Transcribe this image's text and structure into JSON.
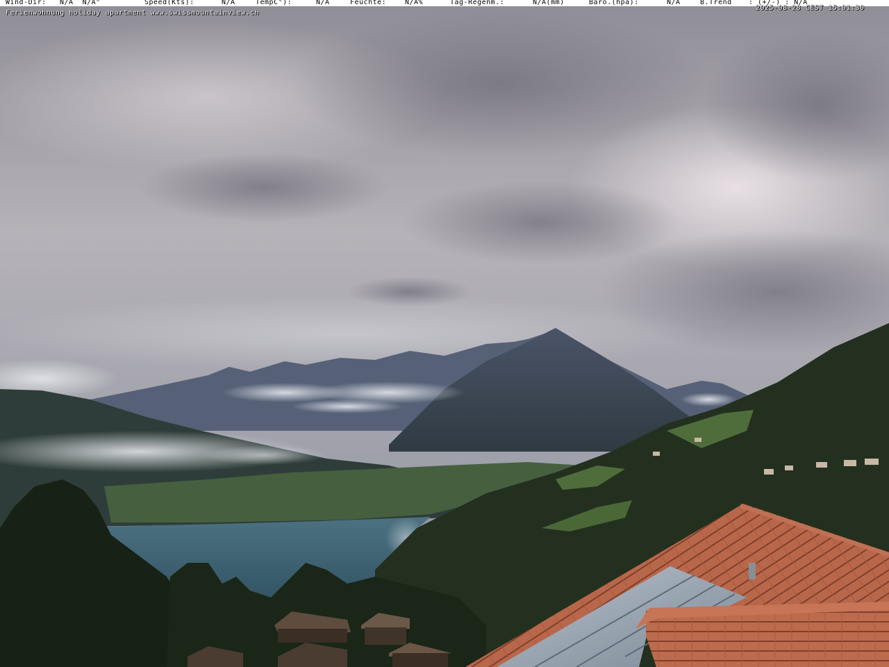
{
  "overlay": {
    "weather": [
      {
        "label": "Wind-Dir:",
        "value": "N/A  N/A°"
      },
      {
        "label": "Speed(Kts):",
        "value": "N/A"
      },
      {
        "label": "TempC°):",
        "value": "N/A"
      },
      {
        "label": "Feuchte:",
        "value": "N/A%"
      },
      {
        "label": "Tag-Regenm.:",
        "value": "N/A(mm)"
      },
      {
        "label": "Baro.(hpa):",
        "value": "N/A"
      },
      {
        "label": "B.Trend",
        "value": ": (+/-) : N/A"
      }
    ],
    "timestamp": "2025-08-28 CEST 15:01:30",
    "caption": "Ferienwohnung holiday apartment www.swissmountainview.ch"
  },
  "colors": {
    "overlay_bar": "#ffffff",
    "overlay_text": "#000000",
    "caption_text": "#ffffff",
    "sky": "#a6a4ac",
    "lake": "#3f6474",
    "mountain": "#3b4558",
    "forest": "#1f2c1f",
    "roof": "#b8654a"
  }
}
